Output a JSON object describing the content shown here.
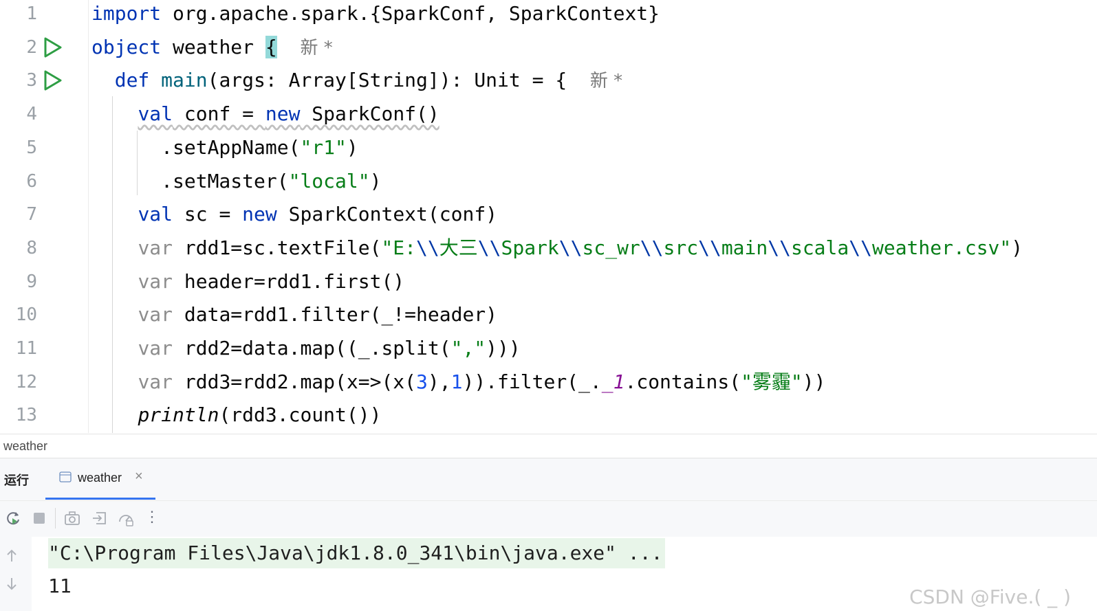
{
  "editor": {
    "line_numbers": [
      "1",
      "2",
      "3",
      "4",
      "5",
      "6",
      "7",
      "8",
      "9",
      "10",
      "11",
      "12",
      "13"
    ],
    "run_icons": [
      "run-icon",
      "run-icon"
    ],
    "lines": [
      [
        {
          "t": "import",
          "c": "kw"
        },
        {
          "t": " org.apache.spark.{SparkConf, SparkContext}",
          "c": ""
        }
      ],
      [
        {
          "t": "object",
          "c": "kw"
        },
        {
          "t": " weather ",
          "c": ""
        },
        {
          "t": "{",
          "c": "brace-hl"
        },
        {
          "t": "  ",
          "c": ""
        },
        {
          "t": "新 *",
          "c": "hint"
        }
      ],
      [
        {
          "t": "  ",
          "c": ""
        },
        {
          "t": "def",
          "c": "kw"
        },
        {
          "t": " ",
          "c": ""
        },
        {
          "t": "main",
          "c": "fn"
        },
        {
          "t": "(args: Array[String]): Unit = {  ",
          "c": ""
        },
        {
          "t": "新 *",
          "c": "hint"
        }
      ],
      [
        {
          "t": "    ",
          "c": ""
        },
        {
          "t": "val",
          "c": "kw uline"
        },
        {
          "t": " conf = ",
          "c": "uline"
        },
        {
          "t": "new",
          "c": "kw uline"
        },
        {
          "t": " SparkConf()",
          "c": "uline"
        }
      ],
      [
        {
          "t": "      .setAppName(",
          "c": ""
        },
        {
          "t": "\"r1\"",
          "c": "str"
        },
        {
          "t": ")",
          "c": ""
        }
      ],
      [
        {
          "t": "      .setMaster(",
          "c": ""
        },
        {
          "t": "\"local\"",
          "c": "str"
        },
        {
          "t": ")",
          "c": ""
        }
      ],
      [
        {
          "t": "    ",
          "c": ""
        },
        {
          "t": "val",
          "c": "kw"
        },
        {
          "t": " sc = ",
          "c": ""
        },
        {
          "t": "new",
          "c": "kw"
        },
        {
          "t": " SparkContext(conf)",
          "c": ""
        }
      ],
      [
        {
          "t": "    ",
          "c": ""
        },
        {
          "t": "var",
          "c": "dim"
        },
        {
          "t": " rdd1=sc.textFile(",
          "c": ""
        },
        {
          "t": "\"E:",
          "c": "str"
        },
        {
          "t": "\\\\",
          "c": "esc"
        },
        {
          "t": "大三",
          "c": "str"
        },
        {
          "t": "\\\\",
          "c": "esc"
        },
        {
          "t": "Spark",
          "c": "str"
        },
        {
          "t": "\\\\",
          "c": "esc"
        },
        {
          "t": "sc_wr",
          "c": "str"
        },
        {
          "t": "\\\\",
          "c": "esc"
        },
        {
          "t": "src",
          "c": "str"
        },
        {
          "t": "\\\\",
          "c": "esc"
        },
        {
          "t": "main",
          "c": "str"
        },
        {
          "t": "\\\\",
          "c": "esc"
        },
        {
          "t": "scala",
          "c": "str"
        },
        {
          "t": "\\\\",
          "c": "esc"
        },
        {
          "t": "weather.csv\"",
          "c": "str"
        },
        {
          "t": ")",
          "c": ""
        }
      ],
      [
        {
          "t": "    ",
          "c": ""
        },
        {
          "t": "var",
          "c": "dim"
        },
        {
          "t": " header=rdd1.first()",
          "c": ""
        }
      ],
      [
        {
          "t": "    ",
          "c": ""
        },
        {
          "t": "var",
          "c": "dim"
        },
        {
          "t": " data=rdd1.filter(_!=header)",
          "c": ""
        }
      ],
      [
        {
          "t": "    ",
          "c": ""
        },
        {
          "t": "var",
          "c": "dim"
        },
        {
          "t": " rdd2=data.map((_.split(",
          "c": ""
        },
        {
          "t": "\",\"",
          "c": "str"
        },
        {
          "t": ")))",
          "c": ""
        }
      ],
      [
        {
          "t": "    ",
          "c": ""
        },
        {
          "t": "var",
          "c": "dim"
        },
        {
          "t": " rdd3=rdd2.map(x=>(x(",
          "c": ""
        },
        {
          "t": "3",
          "c": "num"
        },
        {
          "t": "),",
          "c": ""
        },
        {
          "t": "1",
          "c": "num"
        },
        {
          "t": ")).filter(_.",
          "c": ""
        },
        {
          "t": "_1",
          "c": "mem"
        },
        {
          "t": ".contains(",
          "c": ""
        },
        {
          "t": "\"雾霾\"",
          "c": "str"
        },
        {
          "t": "))",
          "c": ""
        }
      ],
      [
        {
          "t": "    ",
          "c": ""
        },
        {
          "t": "println",
          "c": "it"
        },
        {
          "t": "(rdd3.count())",
          "c": ""
        }
      ]
    ]
  },
  "breadcrumb": {
    "label": "weather"
  },
  "run_panel": {
    "title": "运行",
    "tab_label": "weather",
    "tab_close": "×",
    "toolbar_icons": [
      "rerun-icon",
      "stop-icon",
      "camera-icon",
      "restore-layout-icon",
      "coverage-icon",
      "more-icon"
    ],
    "more_label": "⋮",
    "side_icons": [
      "up-arrow-icon",
      "down-arrow-icon"
    ],
    "console_lines": [
      "\"C:\\Program Files\\Java\\jdk1.8.0_341\\bin\\java.exe\" ...",
      "11"
    ]
  },
  "watermark": "CSDN @Five.(    _  )"
}
